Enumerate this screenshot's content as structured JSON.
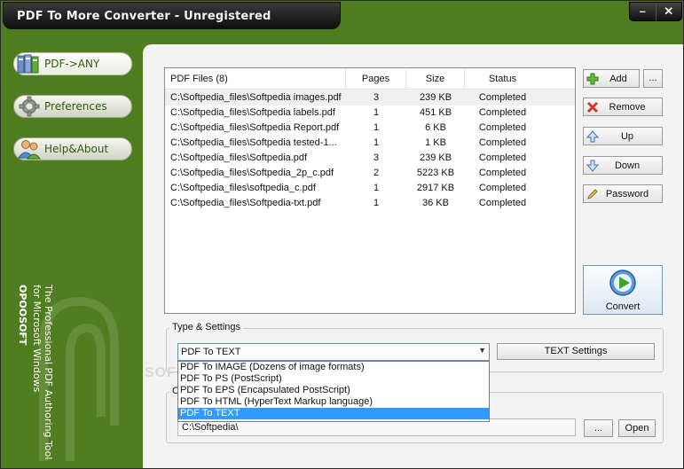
{
  "window": {
    "title": "PDF To More Converter - Unregistered",
    "minimize_glyph": "–",
    "close_glyph": "✕"
  },
  "sidebar": {
    "items": [
      {
        "label": "PDF->ANY",
        "icon": "pdf-stack-icon",
        "active": true
      },
      {
        "label": "Preferences",
        "icon": "gear-icon",
        "active": false
      },
      {
        "label": "Help&About",
        "icon": "users-icon",
        "active": false
      }
    ],
    "brand": "OPOOSOFT",
    "tagline_1": "The Professional PDF Authoring Tool",
    "tagline_2": "for Microsoft Windows"
  },
  "filelist": {
    "headers": {
      "files": "PDF Files (8)",
      "pages": "Pages",
      "size": "Size",
      "status": "Status"
    },
    "rows": [
      {
        "file": "C:\\Softpedia_files\\Softpedia images.pdf",
        "pages": "3",
        "size": "239 KB",
        "status": "Completed"
      },
      {
        "file": "C:\\Softpedia_files\\Softpedia labels.pdf",
        "pages": "1",
        "size": "451 KB",
        "status": "Completed"
      },
      {
        "file": "C:\\Softpedia_files\\Softpedia Report.pdf",
        "pages": "1",
        "size": "6 KB",
        "status": "Completed"
      },
      {
        "file": "C:\\Softpedia_files\\Softpedia tested-1...",
        "pages": "1",
        "size": "1 KB",
        "status": "Completed"
      },
      {
        "file": "C:\\Softpedia_files\\Softpedia.pdf",
        "pages": "3",
        "size": "239 KB",
        "status": "Completed"
      },
      {
        "file": "C:\\Softpedia_files\\Softpedia_2p_c.pdf",
        "pages": "2",
        "size": "5223 KB",
        "status": "Completed"
      },
      {
        "file": "C:\\Softpedia_files\\softpedia_c.pdf",
        "pages": "1",
        "size": "2917 KB",
        "status": "Completed"
      },
      {
        "file": "C:\\Softpedia_files\\Softpedia-txt.pdf",
        "pages": "1",
        "size": "36 KB",
        "status": "Completed"
      }
    ]
  },
  "actions": {
    "add": "Add",
    "more": "...",
    "remove": "Remove",
    "up": "Up",
    "down": "Down",
    "password": "Password",
    "convert": "Convert"
  },
  "settings": {
    "group_label": "Type & Settings",
    "selected_type": "PDF To TEXT",
    "type_options": [
      "PDF To IMAGE (Dozens of image formats)",
      "PDF To PS (PostScript)",
      "PDF To EPS (Encapsulated PostScript)",
      "PDF To HTML (HyperText Markup language)",
      "PDF To TEXT"
    ],
    "settings_button": "TEXT Settings",
    "watermark": "SOF"
  },
  "output": {
    "group_label": "C",
    "path": "C:\\Softpedia\\",
    "browse": "...",
    "open": "Open"
  },
  "colors": {
    "frame_green": "#4f7d1f",
    "accent_green": "#2d5a10",
    "selection_blue": "#3399ff",
    "convert_border": "#6e94c0"
  }
}
